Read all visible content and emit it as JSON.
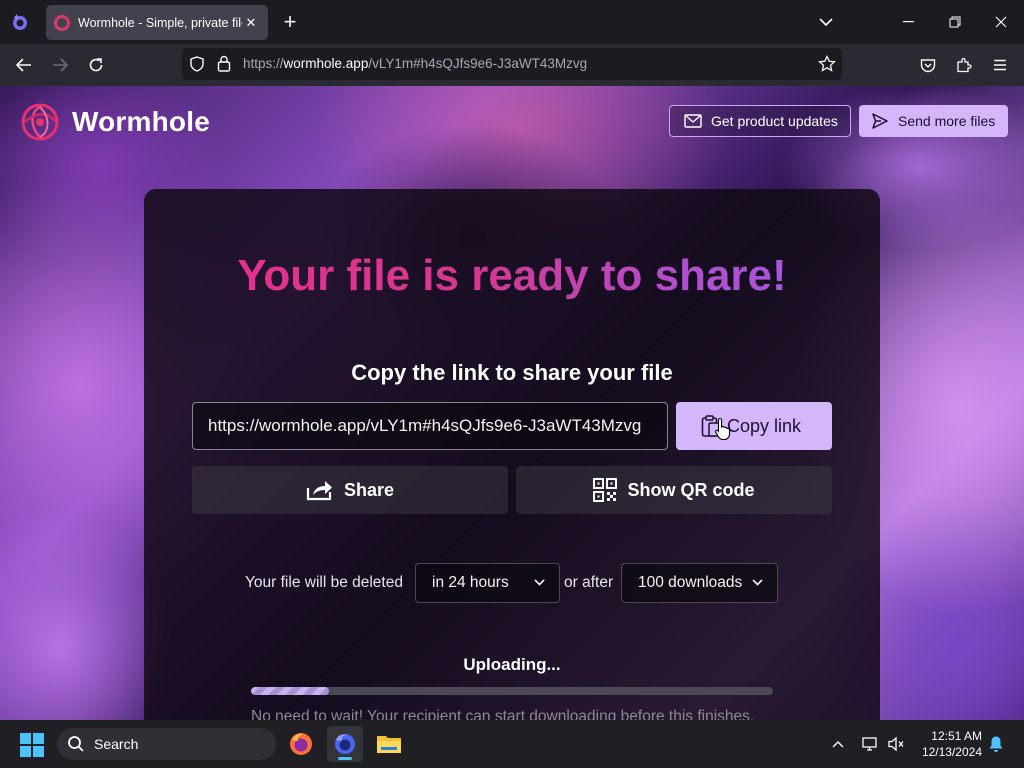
{
  "browser": {
    "tab_title": "Wormhole - Simple, private file",
    "url_prefix": "https://",
    "url_host": "wormhole.app",
    "url_path": "/vLY1m#h4sQJfs9e6-J3aWT43Mzvg"
  },
  "header": {
    "brand": "Wormhole",
    "updates_button": "Get product updates",
    "send_button": "Send more files"
  },
  "card": {
    "headline": "Your file is ready to share!",
    "subhead": "Copy the link to share your file",
    "share_link": "https://wormhole.app/vLY1m#h4sQJfs9e6-J3aWT43Mzvg",
    "copy_button": "Copy link",
    "share_button": "Share",
    "qr_button": "Show QR code",
    "expire_prefix": "Your file will be deleted",
    "expire_time": "in 24 hours",
    "expire_middle": "or after",
    "expire_downloads": "100 downloads",
    "upload_status": "Uploading...",
    "upload_progress": 0.15,
    "upload_note": "No need to wait! Your recipient can start downloading before this finishes."
  },
  "taskbar": {
    "search_placeholder": "Search",
    "time": "12:51 AM",
    "date": "12/13/2024"
  },
  "colors": {
    "accent": "#d6b6fb",
    "headline_start": "#ef2d8e",
    "headline_end": "#9b5ee0",
    "windows_accent": "#4cc2ff"
  }
}
